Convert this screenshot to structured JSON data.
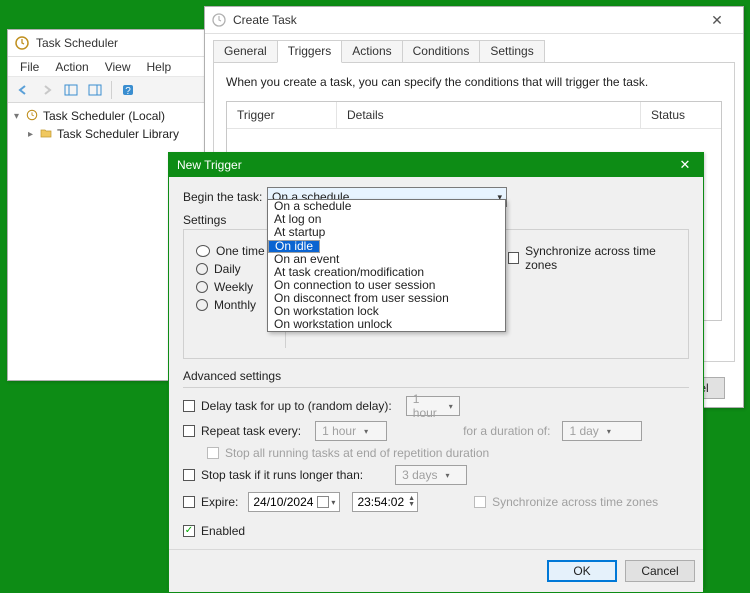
{
  "scheduler": {
    "title": "Task Scheduler",
    "menu": [
      "File",
      "Action",
      "View",
      "Help"
    ],
    "tree_root": "Task Scheduler (Local)",
    "tree_child": "Task Scheduler Library"
  },
  "createTask": {
    "title": "Create Task",
    "tabs": [
      "General",
      "Triggers",
      "Actions",
      "Conditions",
      "Settings"
    ],
    "activeTab": "Triggers",
    "desc": "When you create a task, you can specify the conditions that will trigger the task.",
    "columns": {
      "trigger": "Trigger",
      "details": "Details",
      "status": "Status"
    },
    "cancel": "Cancel"
  },
  "newTrigger": {
    "title": "New Trigger",
    "beginLabel": "Begin the task:",
    "beginValue": "On a schedule",
    "options": [
      "On a schedule",
      "At log on",
      "At startup",
      "On idle",
      "On an event",
      "At task creation/modification",
      "On connection to user session",
      "On disconnect from user session",
      "On workstation lock",
      "On workstation unlock"
    ],
    "highlightedOption": "On idle",
    "settingsLabel": "Settings",
    "recurrence": {
      "onetime": "One time",
      "daily": "Daily",
      "weekly": "Weekly",
      "monthly": "Monthly"
    },
    "syncTZ1": "Synchronize across time zones",
    "advancedLabel": "Advanced settings",
    "delay": "Delay task for up to (random delay):",
    "delayVal": "1 hour",
    "repeat": "Repeat task every:",
    "repeatVal": "1 hour",
    "durationLabel": "for a duration of:",
    "durationVal": "1 day",
    "stopAll": "Stop all running tasks at end of repetition duration",
    "stopIf": "Stop task if it runs longer than:",
    "stopIfVal": "3 days",
    "expire": "Expire:",
    "expireDate": "24/10/2024",
    "expireTime": "23:54:02",
    "syncTZ2": "Synchronize across time zones",
    "enabled": "Enabled",
    "ok": "OK",
    "cancel": "Cancel"
  }
}
